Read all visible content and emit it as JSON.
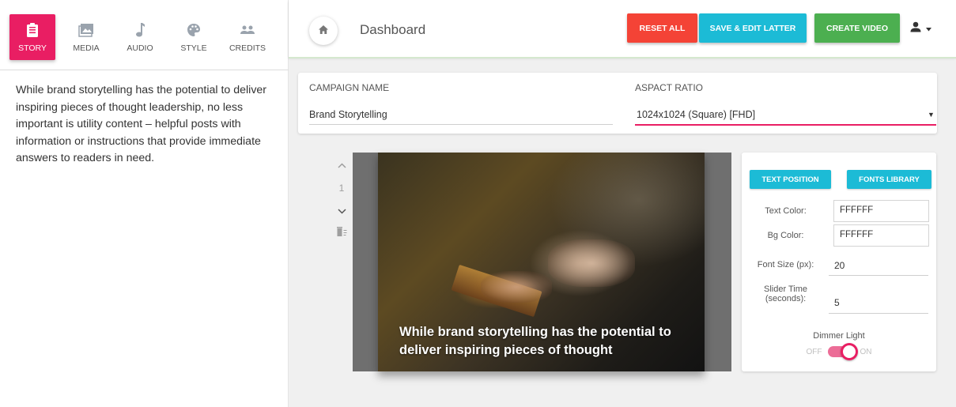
{
  "sidebar": {
    "tabs": [
      {
        "label": "STORY",
        "icon": "clipboard-icon",
        "active": true
      },
      {
        "label": "MEDIA",
        "icon": "image-icon",
        "active": false
      },
      {
        "label": "AUDIO",
        "icon": "music-note-icon",
        "active": false
      },
      {
        "label": "STYLE",
        "icon": "palette-icon",
        "active": false
      },
      {
        "label": "CREDITS",
        "icon": "people-icon",
        "active": false
      }
    ],
    "story_text": "While brand storytelling has the potential to deliver inspiring pieces of thought leadership, no less important is utility content – helpful posts with information or instructions that provide immediate answers to readers in need."
  },
  "header": {
    "title": "Dashboard",
    "home_icon": "home-icon",
    "buttons": {
      "reset": "RESET ALL",
      "save": "SAVE & EDIT LATTER",
      "create": "CREATE VIDEO"
    },
    "colors": {
      "reset": "#f44336",
      "save": "#1cbbd6",
      "create": "#4caf50",
      "accent": "#e91e63"
    }
  },
  "campaign": {
    "name_label": "CAMPAIGN NAME",
    "name_value": "Brand Storytelling",
    "ratio_label": "ASPACT RATIO",
    "ratio_value": "1024x1024 (Square) [FHD]"
  },
  "slide": {
    "number": "1",
    "caption": "While brand storytelling has the potential to deliver inspiring pieces of thought"
  },
  "properties": {
    "text_position_button": "TEXT POSITION",
    "fonts_library_button": "FONTS LIBRARY",
    "text_color_label": "Text Color:",
    "text_color_value": "FFFFFF",
    "bg_color_label": "Bg Color:",
    "bg_color_value": "FFFFFF",
    "font_size_label": "Font Size (px):",
    "font_size_value": "20",
    "slider_time_label_1": "Slider Time",
    "slider_time_label_2": "(seconds):",
    "slider_time_value": "5",
    "dimmer_label": "Dimmer Light",
    "toggle_off": "OFF",
    "toggle_on": "ON",
    "dimmer_on": true
  }
}
